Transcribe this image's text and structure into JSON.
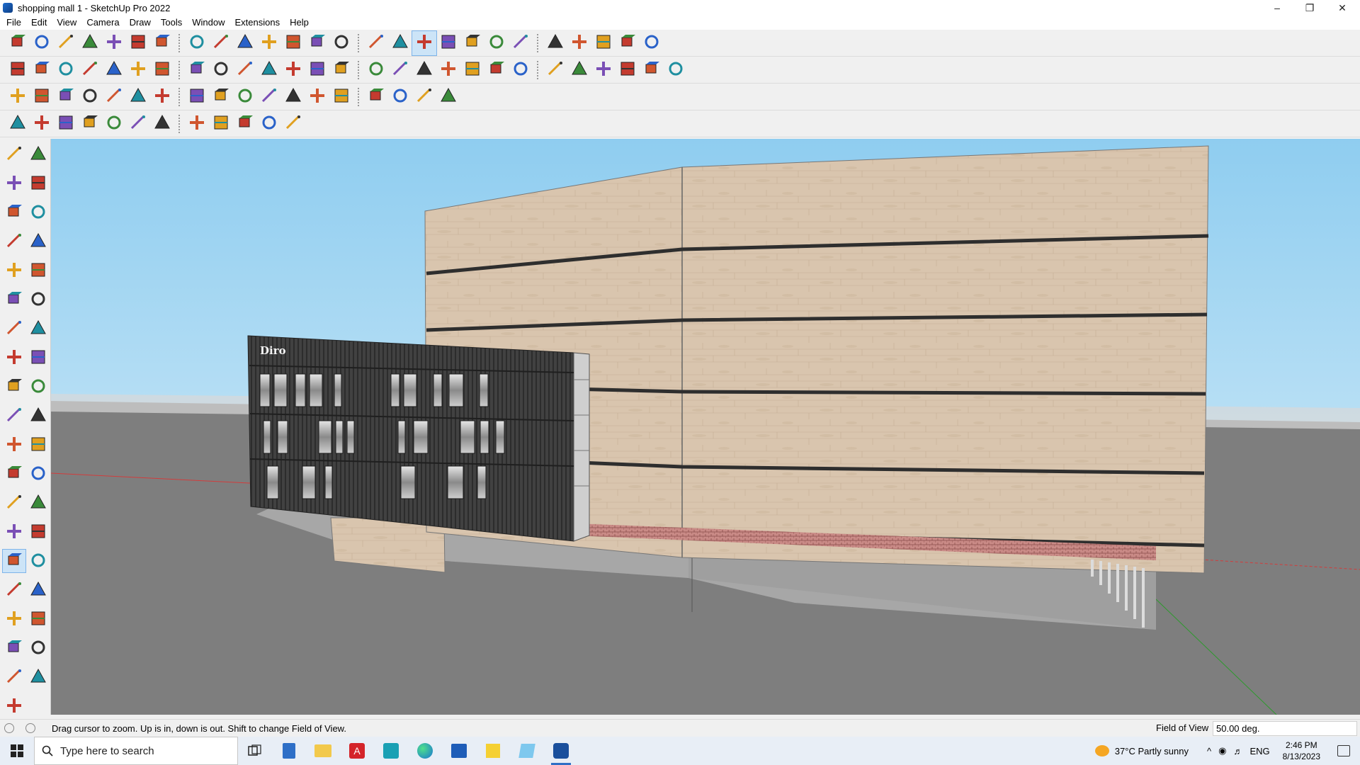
{
  "window": {
    "title": "shopping mall 1 - SketchUp Pro 2022",
    "controls": {
      "minimize": "–",
      "restore": "❐",
      "close": "✕"
    }
  },
  "menu": [
    "File",
    "Edit",
    "View",
    "Camera",
    "Draw",
    "Tools",
    "Window",
    "Extensions",
    "Help"
  ],
  "toolbars": {
    "row1": [
      "zoom-icon",
      "select-icon",
      "eraser-icon",
      "pencil-icon",
      "lasso-icon",
      "rectangle-icon",
      "pushpull-icon",
      "followme-icon",
      "move-icon",
      "rotate-icon",
      "scale-icon",
      "tape-icon",
      "text-icon",
      "paint-icon",
      "orbit-icon",
      "pan-icon",
      "zoom-window-icon",
      "zoom-extents-icon",
      "section-icon",
      "layers-icon",
      "warehouse-icon",
      "sandbox-icon",
      "sync-icon",
      "undo-icon",
      "redo-icon",
      "hand-icon"
    ],
    "row2": [
      "box-icon",
      "views-icon",
      "iso-icon",
      "top-icon",
      "front-icon",
      "right-icon",
      "back-icon",
      "left-icon",
      "bottom-icon",
      "style-icon",
      "xray-icon",
      "wire-icon",
      "hidden-icon",
      "shaded-icon",
      "textured-icon",
      "mono-icon",
      "house-icon",
      "home-icon",
      "roof-icon",
      "fx-icon",
      "shape-icon",
      "circle-icon",
      "polygon-icon",
      "arc-icon",
      "freehand-icon",
      "sphere-icon",
      "cylinder-icon"
    ],
    "row3": [
      "solid-icon",
      "union-icon",
      "subtract-icon",
      "trim-icon",
      "split-icon",
      "outer-icon",
      "intersect-icon",
      "rect-icon",
      "grid-icon",
      "window-icon",
      "door-icon",
      "stair-icon",
      "bridge-icon",
      "tube-icon",
      "bezier-icon",
      "cross-icon",
      "shapebender-icon",
      "dimension-icon"
    ],
    "row4": [
      "vertex-icon",
      "curve-icon",
      "soften-icon",
      "knife-icon",
      "weld-icon",
      "extrude-icon",
      "loft-icon",
      "sweep-icon",
      "twist-icon",
      "bend-icon",
      "flow-icon",
      "fillet-icon"
    ]
  },
  "left_toolbar": {
    "labels": [
      "select-tool-icon",
      "orbit-tool-icon",
      "paint-tool-icon",
      "eraser-tool-icon",
      "component-tool-icon",
      "tape-tool-icon",
      "line-tool-icon",
      "freehand-tool-icon",
      "rectangle-tool-icon",
      "rotated-rectangle-tool-icon",
      "circle-tool-icon",
      "polygon-tool-icon",
      "arc-tool-icon",
      "pie-tool-icon",
      "move-tool-icon",
      "pushpull-tool-icon",
      "rotate-tool-icon",
      "followme-tool-icon",
      "scale-tool-icon",
      "offset-tool-icon",
      "tape-measure-tool-icon",
      "dimension-tool-icon",
      "protractor-tool-icon",
      "text-tool-icon",
      "axes-tool-icon",
      "3dtext-tool-icon",
      "orbit-view-icon",
      "pan-view-icon",
      "zoom-view-icon",
      "zoom-window-view-icon",
      "zoom-extents-view-icon",
      "previous-view-icon",
      "walk-tool-icon",
      "lookaround-tool-icon",
      "position-camera-icon",
      "section-plane-icon",
      "section-display-icon",
      "section-fill-icon",
      "layer-tool-icon"
    ]
  },
  "scene": {
    "sign_text": "Diro"
  },
  "status": {
    "message": "Drag cursor to zoom.  Up is in, down is out. Shift to change Field of View.",
    "measurement_label": "Field of View",
    "measurement_value": "50.00 deg."
  },
  "taskbar": {
    "search_placeholder": "Type here to search",
    "weather": "37°C  Partly sunny",
    "language": "ENG",
    "time": "2:46 PM",
    "date": "8/13/2023"
  },
  "colors": {
    "sky_top": "#9ed3f2",
    "sky_bottom": "#dff0f8",
    "ground": "#7d7d7d",
    "wood": "#d8c4ad",
    "dark_cladding": "#3e3e3e",
    "accent_select": "#cce4f7"
  }
}
